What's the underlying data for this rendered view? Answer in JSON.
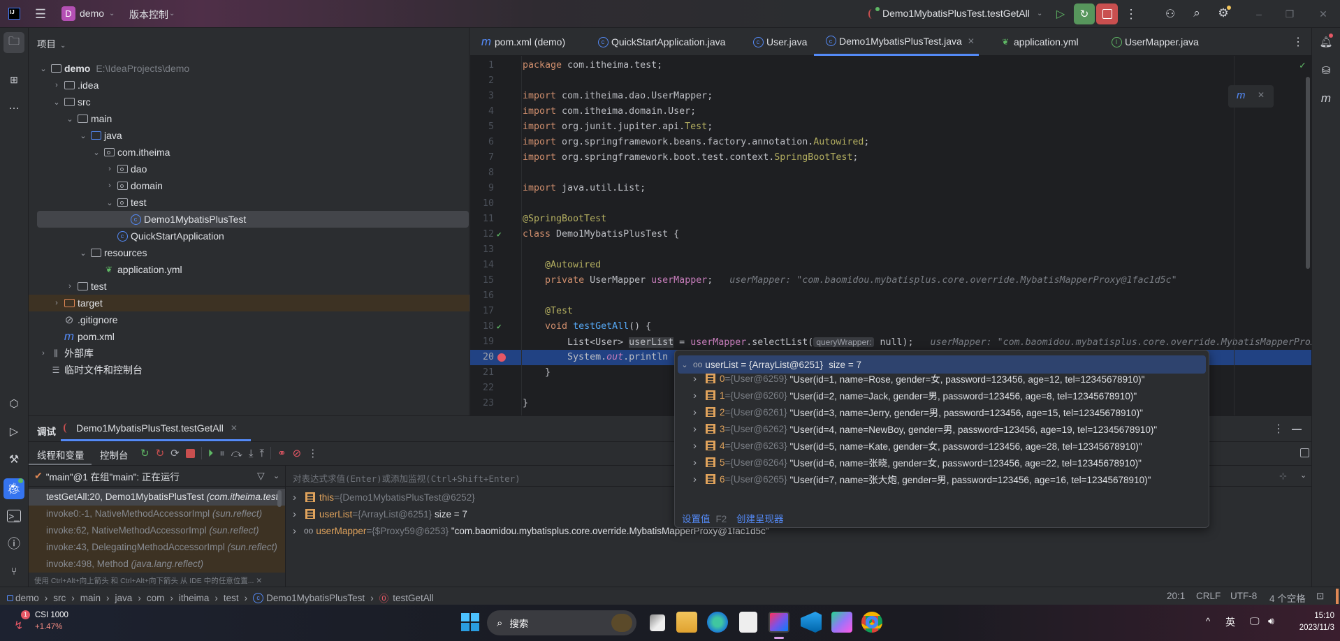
{
  "titlebar": {
    "project_badge": "D",
    "project_name": "demo",
    "vcs_menu": "版本控制",
    "run_config": "Demo1MybatisPlusTest.testGetAll"
  },
  "colors": {
    "accent": "#548af7",
    "debug_active": "#57965c",
    "stop": "#c94f4f",
    "current_line": "#214283"
  },
  "project": {
    "header": "项目",
    "tree": [
      {
        "label": "demo",
        "extra": "E:\\IdeaProjects\\demo",
        "depth": 0,
        "chevron": "down",
        "icon": "module",
        "bold": true
      },
      {
        "label": ".idea",
        "depth": 1,
        "chevron": "right",
        "icon": "folder"
      },
      {
        "label": "src",
        "depth": 1,
        "chevron": "down",
        "icon": "folder"
      },
      {
        "label": "main",
        "depth": 2,
        "chevron": "down",
        "icon": "folder"
      },
      {
        "label": "java",
        "depth": 3,
        "chevron": "down",
        "icon": "source-folder"
      },
      {
        "label": "com.itheima",
        "depth": 4,
        "chevron": "down",
        "icon": "package"
      },
      {
        "label": "dao",
        "depth": 5,
        "chevron": "right",
        "icon": "package"
      },
      {
        "label": "domain",
        "depth": 5,
        "chevron": "right",
        "icon": "package"
      },
      {
        "label": "test",
        "depth": 5,
        "chevron": "down",
        "icon": "package"
      },
      {
        "label": "Demo1MybatisPlusTest",
        "depth": 6,
        "chevron": "",
        "icon": "class",
        "selected": true
      },
      {
        "label": "QuickStartApplication",
        "depth": 5,
        "chevron": "",
        "icon": "spring-class"
      },
      {
        "label": "resources",
        "depth": 3,
        "chevron": "down",
        "icon": "resources"
      },
      {
        "label": "application.yml",
        "depth": 4,
        "chevron": "",
        "icon": "yml"
      },
      {
        "label": "test",
        "depth": 2,
        "chevron": "right",
        "icon": "folder"
      },
      {
        "label": "target",
        "depth": 1,
        "chevron": "right",
        "icon": "excluded-folder",
        "excluded": true
      },
      {
        "label": ".gitignore",
        "depth": 1,
        "chevron": "",
        "icon": "gitignore"
      },
      {
        "label": "pom.xml",
        "depth": 1,
        "chevron": "",
        "icon": "maven"
      },
      {
        "label": "外部库",
        "depth": 0,
        "chevron": "right",
        "icon": "library"
      },
      {
        "label": "临时文件和控制台",
        "depth": 0,
        "chevron": "",
        "icon": "scratch"
      }
    ]
  },
  "editor_tabs": [
    {
      "label": "pom.xml (demo)",
      "icon": "maven"
    },
    {
      "label": "QuickStartApplication.java",
      "icon": "spring-class"
    },
    {
      "label": "User.java",
      "icon": "class"
    },
    {
      "label": "Demo1MybatisPlusTest.java",
      "icon": "class",
      "active": true
    },
    {
      "label": "application.yml",
      "icon": "yml"
    },
    {
      "label": "UserMapper.java",
      "icon": "interface"
    }
  ],
  "code": {
    "current_line": 20,
    "lines": [
      [
        [
          "package",
          "kw"
        ],
        [
          " com.itheima.test;",
          ""
        ]
      ],
      [],
      [
        [
          "import",
          "kw"
        ],
        [
          " com.itheima.dao.UserMapper;",
          ""
        ]
      ],
      [
        [
          "import",
          "kw"
        ],
        [
          " com.itheima.domain.User;",
          ""
        ]
      ],
      [
        [
          "import",
          "kw"
        ],
        [
          " org.junit.jupiter.api.",
          ""
        ],
        [
          "Test",
          "ann"
        ],
        [
          ";",
          ""
        ]
      ],
      [
        [
          "import",
          "kw"
        ],
        [
          " org.springframework.beans.factory.annotation.",
          ""
        ],
        [
          "Autowired",
          "ann"
        ],
        [
          ";",
          ""
        ]
      ],
      [
        [
          "import",
          "kw"
        ],
        [
          " org.springframework.boot.test.context.",
          ""
        ],
        [
          "SpringBootTest",
          "ann"
        ],
        [
          ";",
          ""
        ]
      ],
      [],
      [
        [
          "import",
          "kw"
        ],
        [
          " java.util.List;",
          ""
        ]
      ],
      [],
      [
        [
          "@SpringBootTest",
          "ann"
        ]
      ],
      [
        [
          "class",
          "kw"
        ],
        [
          " Demo1MybatisPlusTest {",
          ""
        ]
      ],
      [],
      [
        [
          "    ",
          ""
        ],
        [
          "@Autowired",
          "ann"
        ]
      ],
      [
        [
          "    ",
          ""
        ],
        [
          "private",
          "kw"
        ],
        [
          " UserMapper ",
          ""
        ],
        [
          "userMapper",
          "fld"
        ],
        [
          ";",
          ""
        ],
        [
          "   userMapper: \"com.baomidou.mybatisplus.core.override.MybatisMapperProxy@1fac1d5c\"",
          "hint"
        ]
      ],
      [],
      [
        [
          "    ",
          ""
        ],
        [
          "@Test",
          "ann"
        ]
      ],
      [
        [
          "    ",
          ""
        ],
        [
          "void",
          "kw"
        ],
        [
          " ",
          ""
        ],
        [
          "testGetAll",
          "mth"
        ],
        [
          "() {",
          ""
        ]
      ],
      [
        [
          "        List<User> ",
          ""
        ],
        [
          "userList",
          "hl"
        ],
        [
          " = ",
          ""
        ],
        [
          "userMapper",
          "fld"
        ],
        [
          ".selectList(",
          ""
        ],
        [
          "queryWrapper:",
          "chip"
        ],
        [
          " null);",
          ""
        ],
        [
          "   userMapper: \"com.baomidou.mybatisplus.core.override.MybatisMapperProxy@1fac1d5c\"",
          "hint"
        ]
      ],
      [
        [
          "        System.",
          ""
        ],
        [
          "out",
          "itf"
        ],
        [
          ".println",
          ""
        ]
      ],
      [
        [
          "    }",
          ""
        ]
      ],
      [],
      [
        [
          "}",
          ""
        ]
      ]
    ]
  },
  "debug": {
    "tab_label": "调试",
    "session": "Demo1MybatisPlusTest.testGetAll",
    "subtabs": [
      "线程和变量",
      "控制台"
    ],
    "thread": "\"main\"@1 在组\"main\": 正在运行",
    "eval_placeholder": "对表达式求值(Enter)或添加监视(Ctrl+Shift+Enter)",
    "frames": [
      {
        "text": "testGetAll:20, Demo1MybatisPlusTest",
        "pkg": "(com.itheima.test)",
        "selected": true
      },
      {
        "text": "invoke0:-1, NativeMethodAccessorImpl",
        "pkg": "(sun.reflect)"
      },
      {
        "text": "invoke:62, NativeMethodAccessorImpl",
        "pkg": "(sun.reflect)"
      },
      {
        "text": "invoke:43, DelegatingMethodAccessorImpl",
        "pkg": "(sun.reflect)"
      },
      {
        "text": "invoke:498, Method",
        "pkg": "(java.lang.reflect)"
      }
    ],
    "hint": "使用 Ctrl+Alt+向上箭头 和 Ctrl+Alt+向下箭头 从 IDE 中的任意位置...",
    "variables": [
      {
        "name": "this",
        "type": "{Demo1MybatisPlusTest@6252}",
        "value": "",
        "icon": "array"
      },
      {
        "name": "userList",
        "type": "{ArrayList@6251}",
        "value": " size = 7",
        "icon": "array"
      },
      {
        "name": "userMapper",
        "type": "{$Proxy59@6253}",
        "value": " \"com.baomidou.mybatisplus.core.override.MybatisMapperProxy@1fac1d5c\"",
        "icon": "watch"
      }
    ]
  },
  "popup": {
    "header": {
      "name": "userList",
      "type": "{ArrayList@6251}",
      "value": "size = 7"
    },
    "items": [
      {
        "index": "0",
        "type": "{User@6259}",
        "value": "\"User(id=1, name=Rose, gender=女, password=123456, age=12, tel=12345678910)\""
      },
      {
        "index": "1",
        "type": "{User@6260}",
        "value": "\"User(id=2, name=Jack, gender=男, password=123456, age=8, tel=12345678910)\""
      },
      {
        "index": "2",
        "type": "{User@6261}",
        "value": "\"User(id=3, name=Jerry, gender=男, password=123456, age=15, tel=12345678910)\""
      },
      {
        "index": "3",
        "type": "{User@6262}",
        "value": "\"User(id=4, name=NewBoy, gender=男, password=123456, age=19, tel=12345678910)\""
      },
      {
        "index": "4",
        "type": "{User@6263}",
        "value": "\"User(id=5, name=Kate, gender=女, password=123456, age=28, tel=12345678910)\""
      },
      {
        "index": "5",
        "type": "{User@6264}",
        "value": "\"User(id=6, name=张晓, gender=女, password=123456, age=22, tel=12345678910)\""
      },
      {
        "index": "6",
        "type": "{User@6265}",
        "value": "\"User(id=7, name=张大炮, gender=男, password=123456, age=16, tel=12345678910)\""
      }
    ],
    "set_value": "设置值",
    "set_value_key": "F2",
    "create_renderer": "创建呈现器"
  },
  "statusbar": {
    "breadcrumbs": [
      "demo",
      "src",
      "main",
      "java",
      "com",
      "itheima",
      "test",
      "Demo1MybatisPlusTest",
      "testGetAll"
    ],
    "position": "20:1",
    "line_sep": "CRLF",
    "encoding": "UTF-8",
    "indent": "4 个空格"
  },
  "taskbar": {
    "stock_name": "CSI 1000",
    "stock_change": "+1.47%",
    "stock_badge": "1",
    "search": "搜索",
    "lang": "英",
    "time": "15:10",
    "date": "2023/11/3"
  }
}
